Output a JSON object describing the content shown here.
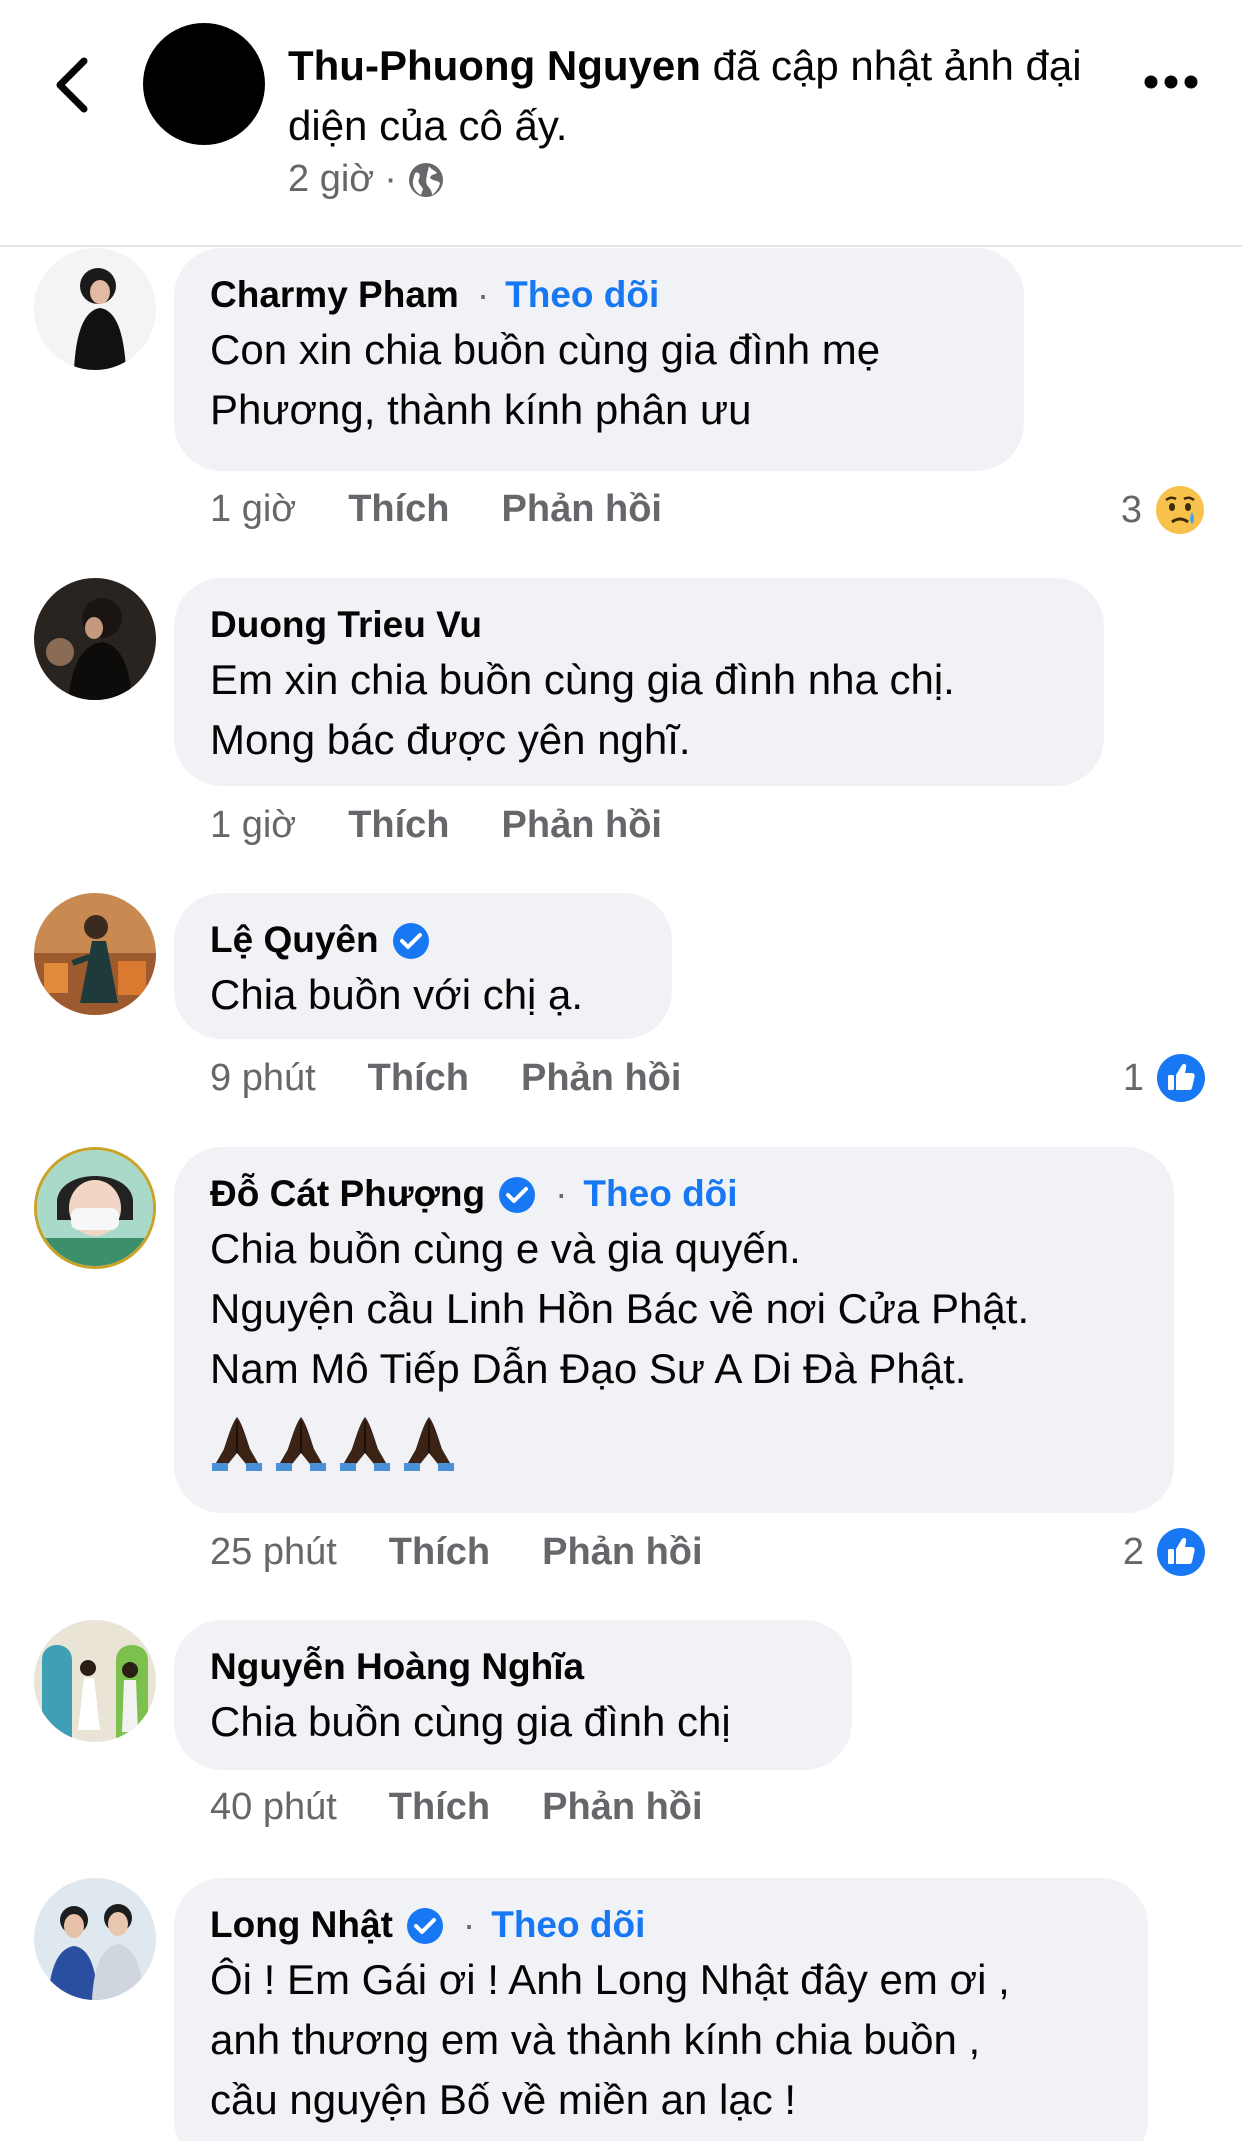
{
  "header": {
    "author": "Thu-Phuong Nguyen",
    "action": "đã cập nhật ảnh đại diện của cô ấy.",
    "time": "2 giờ",
    "separator": "·"
  },
  "labels": {
    "like": "Thích",
    "reply": "Phản hồi",
    "follow": "Theo dõi",
    "dot": "·"
  },
  "comments": [
    {
      "name": "Charmy Pham",
      "verified": false,
      "follow": true,
      "lines": [
        "Con xin chia buồn cùng gia đình mẹ",
        "Phương, thành kính phân ưu"
      ],
      "time": "1 giờ",
      "reaction_count": "3",
      "reaction": "sad"
    },
    {
      "name": "Duong Trieu Vu",
      "verified": false,
      "follow": false,
      "lines": [
        "Em xin chia buồn cùng gia đình nha chị.",
        "Mong bác được yên nghĩ."
      ],
      "time": "1 giờ"
    },
    {
      "name": "Lệ Quyên",
      "verified": true,
      "follow": false,
      "lines": [
        "Chia buồn với chị ạ."
      ],
      "time": "9 phút",
      "reaction_count": "1",
      "reaction": "like"
    },
    {
      "name": "Đỗ Cát Phượng",
      "verified": true,
      "follow": true,
      "lines": [
        "Chia buồn cùng e và gia quyến.",
        "Nguyện cầu Linh Hồn Bác về nơi Cửa Phật.",
        "Nam Mô Tiếp Dẫn Đạo Sư A Di Đà Phật."
      ],
      "emoji_count": 4,
      "time": "25 phút",
      "reaction_count": "2",
      "reaction": "like"
    },
    {
      "name": "Nguyễn Hoàng Nghĩa",
      "verified": false,
      "follow": false,
      "lines": [
        "Chia buồn cùng gia đình chị"
      ],
      "time": "40 phút"
    },
    {
      "name": "Long Nhật",
      "verified": true,
      "follow": true,
      "lines": [
        "Ôi ! Em Gái ơi ! Anh Long Nhật đây em ơi ,",
        "anh thương em và thành kính chia buồn ,",
        "cầu nguyện Bố về miền an lạc !"
      ]
    }
  ],
  "colors": {
    "link": "#1877f2",
    "bubble": "#f0f2f5",
    "meta": "#65676b",
    "text": "#050505"
  },
  "icons": {
    "back": "chevron-left-icon",
    "more": "more-horizontal-icon",
    "globe": "globe-icon",
    "verified": "verified-badge-icon",
    "sad": "sad-reaction-icon",
    "like": "like-reaction-icon",
    "pray": "folded-hands-icon"
  }
}
